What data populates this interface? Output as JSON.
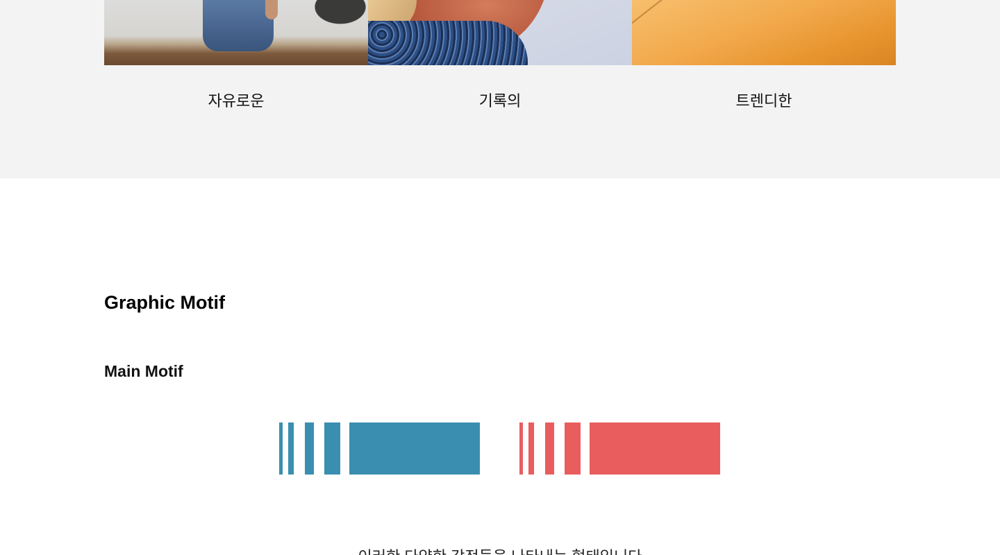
{
  "gallery": {
    "items": [
      {
        "caption": "자유로운",
        "image": "woman-sitting-on-rock-photo"
      },
      {
        "caption": "기록의",
        "image": "person-sketching-photo"
      },
      {
        "caption": "트렌디한",
        "image": "orange-paper-photo"
      }
    ]
  },
  "motif_section": {
    "title": "Graphic Motif",
    "subtitle": "Main Motif",
    "colors": {
      "primary": "#3a8fb0",
      "secondary": "#e95d5e",
      "gallery_background": "#f3f3f3"
    },
    "bottom_text": "이러한 다양한 감정들을 나타내는 형태입니다"
  }
}
